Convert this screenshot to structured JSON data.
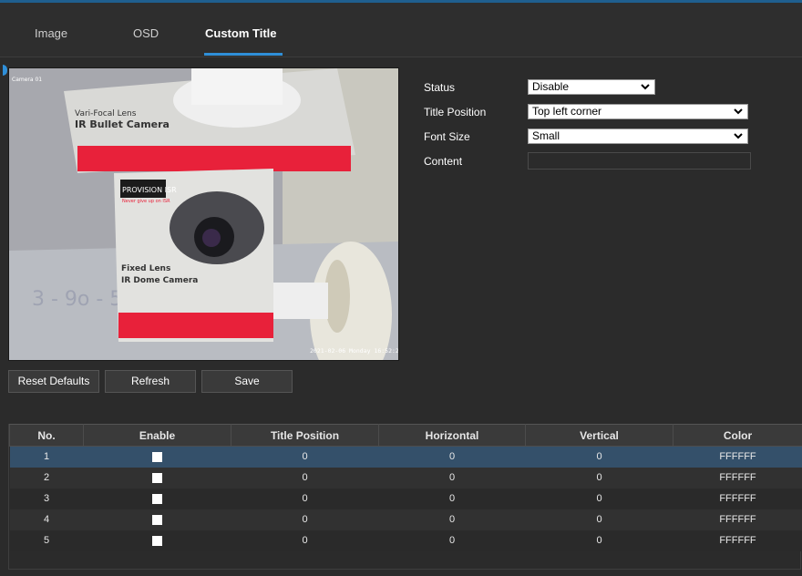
{
  "tabs": [
    {
      "label": "Image",
      "active": false
    },
    {
      "label": "OSD",
      "active": false
    },
    {
      "label": "Custom Title",
      "active": true
    }
  ],
  "preview": {
    "overlay_timestamp": "2021-02-06 Monday 16:52:29",
    "overlay_channel": "Camera 01",
    "box_top_text": "Vari-Focal Lens",
    "box_top_text2": "IR Bullet Camera",
    "box_bottom_text": "Fixed Lens",
    "box_bottom_text2": "IR Dome Camera",
    "brand": "PROVISION ISR",
    "brand_tag": "Never give up on ISR"
  },
  "settings": {
    "status_label": "Status",
    "status_value": "Disable",
    "title_position_label": "Title Position",
    "title_position_value": "Top left corner",
    "font_size_label": "Font Size",
    "font_size_value": "Small",
    "content_label": "Content",
    "content_value": ""
  },
  "buttons": {
    "reset": "Reset Defaults",
    "refresh": "Refresh",
    "save": "Save"
  },
  "table": {
    "headers": [
      "No.",
      "Enable",
      "Title Position",
      "Horizontal",
      "Vertical",
      "Color"
    ],
    "rows": [
      {
        "no": "1",
        "enable": true,
        "title_position": "0",
        "horizontal": "0",
        "vertical": "0",
        "color": "FFFFFF",
        "selected": true
      },
      {
        "no": "2",
        "enable": true,
        "title_position": "0",
        "horizontal": "0",
        "vertical": "0",
        "color": "FFFFFF",
        "selected": false
      },
      {
        "no": "3",
        "enable": true,
        "title_position": "0",
        "horizontal": "0",
        "vertical": "0",
        "color": "FFFFFF",
        "selected": false
      },
      {
        "no": "4",
        "enable": true,
        "title_position": "0",
        "horizontal": "0",
        "vertical": "0",
        "color": "FFFFFF",
        "selected": false
      },
      {
        "no": "5",
        "enable": true,
        "title_position": "0",
        "horizontal": "0",
        "vertical": "0",
        "color": "FFFFFF",
        "selected": false
      }
    ]
  },
  "colors": {
    "accent": "#2f8fd8",
    "background": "#2b2b2b",
    "selected_row": "#34506a",
    "product_red": "#e8213a"
  }
}
